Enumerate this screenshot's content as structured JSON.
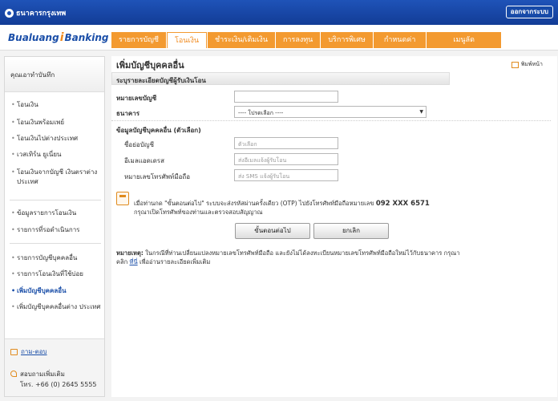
{
  "header": {
    "bank_name": "ธนาคารกรุงเทพ",
    "logout_label": "ออกจากระบบ"
  },
  "brand": {
    "name_left": "Bualuang",
    "name_right": "Banking"
  },
  "nav": {
    "tabs": [
      {
        "label": "รายการบัญชี"
      },
      {
        "label": "โอนเงิน",
        "active": true
      },
      {
        "label": "ชำระเงิน/เติมเงิน"
      },
      {
        "label": "การลงทุน"
      },
      {
        "label": "บริการพิเศษ"
      },
      {
        "label": "กำหนดค่า"
      },
      {
        "label": "เมนูลัด"
      }
    ]
  },
  "sidebar": {
    "heading": "คุณเอาทำบันทึก",
    "items": [
      {
        "label": "โอนเงิน"
      },
      {
        "label": "โอนเงินพร้อมเพย์"
      },
      {
        "label": "โอนเงินไปต่างประเทศ"
      },
      {
        "label": "เวสเทิร์น ยูเนี่ยน"
      },
      {
        "label": "โอนเงินจากบัญชี เงินตราต่างประเทศ"
      },
      {
        "label": "ข้อมูลรายการโอนเงิน"
      },
      {
        "label": "รายการที่รอดำเนินการ"
      },
      {
        "label": "รายการบัญชีบุคคลอื่น"
      },
      {
        "label": "รายการโอนเงินที่ใช้บ่อย"
      },
      {
        "label": "เพิ่มบัญชีบุคคลอื่น",
        "active": true
      },
      {
        "label": "เพิ่มบัญชีบุคคลอื่นต่าง ประเทศ"
      }
    ],
    "help_label": "ถาม-ตอบ",
    "contact_line1": "สอบถามเพิ่มเติม",
    "contact_line2": "โทร. +66 (0) 2645 5555"
  },
  "main": {
    "title": "เพิ่มบัญชีบุคคลอื่น",
    "print_label": "พิมพ์หน้า",
    "section_title": "ระบุรายละเอียดบัญชีผู้รับเงินโอน",
    "account_label": "หมายเลขบัญชี",
    "bank_label": "ธนาคาร",
    "bank_select_value": "---- โปรดเลือก ----",
    "optional_heading": "ข้อมูลบัญชีบุคคลอื่น (ตัวเลือก)",
    "nickname_label": "ชื่อย่อบัญชี",
    "nickname_placeholder": "ตัวเลือก",
    "email_label": "อีเมลแอดเดรส",
    "email_placeholder": "ส่งอีเมลแจ้งผู้รับโอน",
    "mobile_label": "หมายเลขโทรศัพท์มือถือ",
    "mobile_placeholder": "ส่ง SMS แจ้งผู้รับโอน",
    "otp_text_before": "เมื่อท่านกด \"ขั้นตอนต่อไป\" ระบบจะส่งรหัสผ่านครั้งเดียว (OTP) ไปยังโทรศัพท์มือถือหมายเลข",
    "otp_phone": "092 XXX 6571",
    "otp_text_line2": "กรุณาเปิดโทรศัพท์ของท่านและตรวจสอบสัญญาณ",
    "next_button": "ขั้นตอนต่อไป",
    "cancel_button": "ยกเลิก",
    "note_label": "หมายเหตุ:",
    "note_text": "ในกรณีที่ท่านเปลี่ยนแปลงหมายเลขโทรศัพท์มือถือ และยังไม่ได้ลงทะเบียนหมายเลขโทรศัพท์มือถือใหม่ไว้กับธนาคาร กรุณาคลิก",
    "note_link": "ที่นี่",
    "note_tail": "เพื่ออ่านรายละเอียดเพิ่มเติม"
  }
}
